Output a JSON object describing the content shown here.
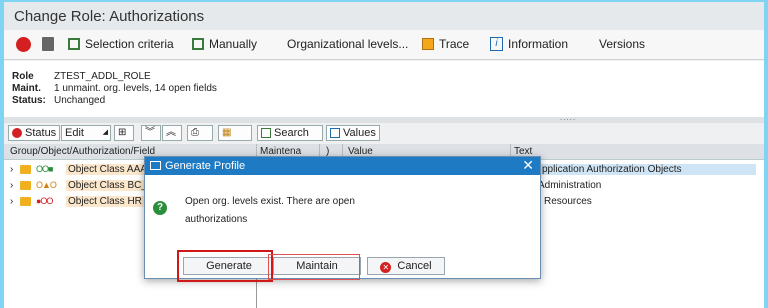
{
  "window": {
    "title": "Change Role: Authorizations"
  },
  "appbar": {
    "selection_criteria": "Selection criteria",
    "manually": "Manually",
    "org_levels": "Organizational levels...",
    "trace": "Trace",
    "information": "Information",
    "versions": "Versions"
  },
  "header": {
    "role_label": "Role",
    "role_value": "ZTEST_ADDL_ROLE",
    "maint_label": "Maint.",
    "maint_value": "1 unmaint. org. levels, 14 open fields",
    "status_label": "Status:",
    "status_value": "Unchanged"
  },
  "toolbar": {
    "status": "Status",
    "edit": "Edit",
    "search": "Search",
    "values": "Values"
  },
  "table": {
    "headers": [
      "Group/Object/Authorization/Field",
      "Maintena",
      ")",
      "Value",
      "Text"
    ],
    "rows": [
      {
        "name": "Object Class AAA",
        "text": "pplication Authorization Objects",
        "status_dots": "OO■"
      },
      {
        "name": "Object Class BC_",
        "text": "Administration",
        "status_dots": "O▲O"
      },
      {
        "name": "Object Class HR",
        "text": "Resources",
        "status_dots": "●OO"
      }
    ]
  },
  "dialog": {
    "title": "Generate Profile",
    "close": "✕",
    "message": "Open org. levels exist. There are open authorizations",
    "generate": "Generate",
    "maintain": "Maintain",
    "cancel": "Cancel"
  },
  "colors": {
    "accent_blue": "#1e7ac2",
    "highlight_red": "#d01818",
    "frame": "#7fd4f4"
  }
}
